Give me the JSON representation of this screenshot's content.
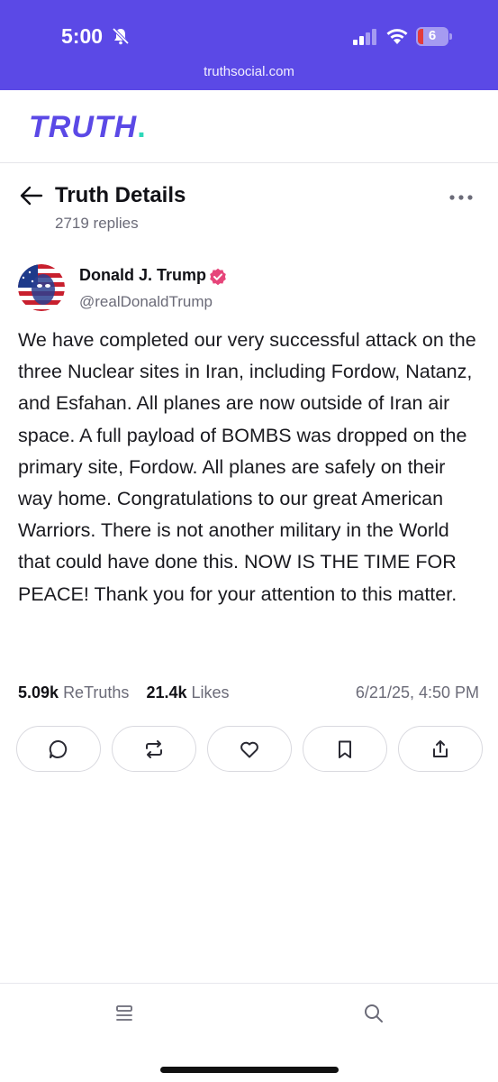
{
  "status_bar": {
    "time": "5:00",
    "battery_level": "6",
    "colors": {
      "bar": "#5b49e6",
      "battery_low": "#e33b3b"
    }
  },
  "browser": {
    "url": "truthsocial.com"
  },
  "app": {
    "logo_text": "TRUTH",
    "logo_dot": ".",
    "colors": {
      "brand": "#5b49e6",
      "accent": "#2fd8b9",
      "verified": "#e6457a"
    }
  },
  "header": {
    "title": "Truth Details",
    "replies": "2719 replies"
  },
  "post": {
    "author_name": "Donald J. Trump",
    "author_handle": "@realDonaldTrump",
    "text": "We have completed our very successful attack on the three Nuclear sites in Iran, including Fordow, Natanz, and Esfahan. All planes are now outside of Iran air space. A full payload of BOMBS was dropped on the primary site, Fordow. All planes are safely on their way home. Congratulations to our great American Warriors. There is not another military in the World that could have done this. NOW IS THE TIME FOR PEACE! Thank you for your attention to this matter.",
    "retruths_count": "5.09k",
    "retruths_label": "ReTruths",
    "likes_count": "21.4k",
    "likes_label": "Likes",
    "timestamp": "6/21/25, 4:50 PM"
  },
  "actions": [
    "reply-icon",
    "retruth-icon",
    "like-icon",
    "bookmark-icon",
    "share-icon"
  ],
  "bottom_nav": [
    "home-icon",
    "search-icon"
  ]
}
